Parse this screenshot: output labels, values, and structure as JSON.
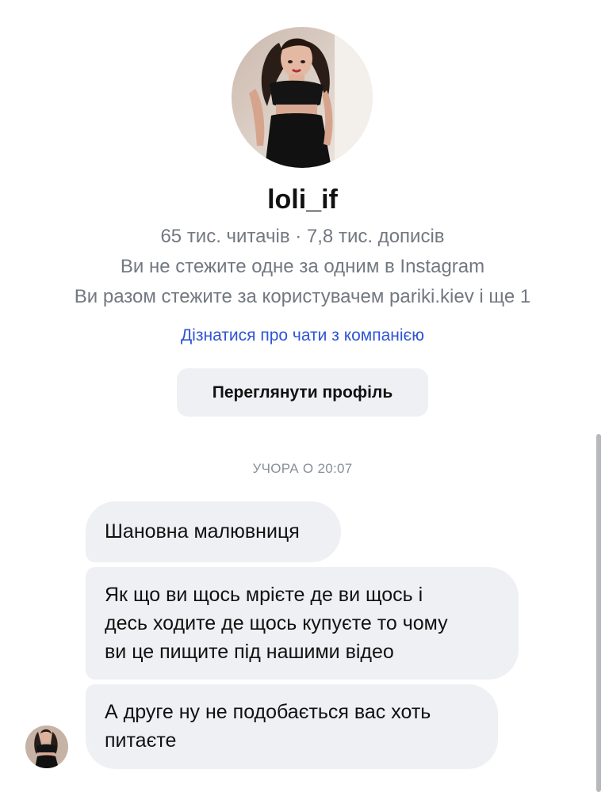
{
  "profile": {
    "avatar_icon": "profile-photo",
    "username": "loli_if",
    "stats": "65 тис. читачів · 7,8 тис. дописів",
    "follow_status": "Ви не стежите одне за одним в Instagram",
    "mutual": "Ви разом стежите за користувачем pariki.kiev і ще 1",
    "business_link": "Дізнатися про чати з компанією",
    "view_profile_label": "Переглянути профіль"
  },
  "chat": {
    "timestamp": "УЧОРА О 20:07",
    "sender_avatar_icon": "profile-photo",
    "messages": [
      {
        "line1": "Шановна малювниця"
      },
      {
        "line1": "Як що ви щось мрієте де ви щось і",
        "line2": "десь ходите де щось купуєте то чому",
        "line3": "ви це пищите під нашими відео"
      },
      {
        "line1": "А друге ну не подобається вас хоть",
        "line2": "питаєте"
      }
    ]
  },
  "colors": {
    "background": "#ffffff",
    "bubble": "#eef0f3",
    "link": "#2f55d4",
    "secondary_text": "#737880"
  }
}
